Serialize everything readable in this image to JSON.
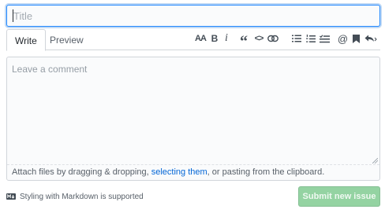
{
  "title_field": {
    "placeholder": "Title",
    "value": ""
  },
  "tabs": [
    {
      "label": "Write",
      "selected": true
    },
    {
      "label": "Preview",
      "selected": false
    }
  ],
  "toolbar": {
    "header_label": "AA",
    "bold_label": "B",
    "italic_label": "i",
    "quote_label": "“",
    "code_label": "<>",
    "mention_label": "@",
    "icons": [
      "text-size-icon",
      "bold-icon",
      "italic-icon",
      "quote-icon",
      "code-icon",
      "link-icon",
      "unordered-list-icon",
      "ordered-list-icon",
      "task-list-icon",
      "mention-icon",
      "saved-reply-icon",
      "reply-arrow-icon"
    ]
  },
  "comment": {
    "placeholder": "Leave a comment",
    "attach_before": "Attach files by dragging & dropping, ",
    "attach_link": "selecting them",
    "attach_after": ", or pasting from the clipboard."
  },
  "footer": {
    "markdown_note": "Styling with Markdown is supported",
    "submit_label": "Submit new issue"
  },
  "colors": {
    "focus_border": "#2188ff",
    "link": "#0366d6",
    "submit_disabled_bg": "#94d3a2"
  }
}
